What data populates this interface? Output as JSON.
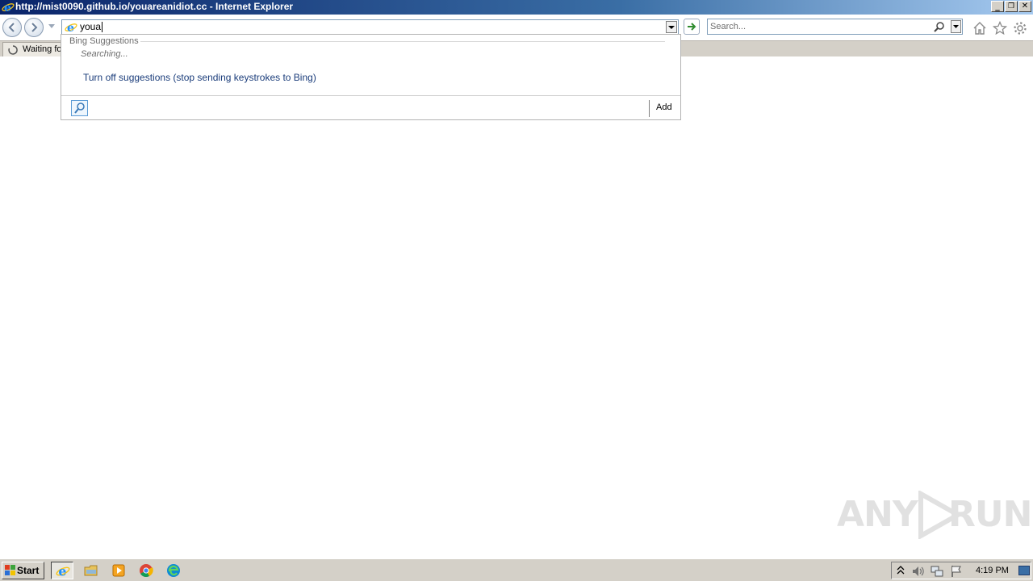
{
  "window": {
    "title": "http://mist0090.github.io/youareanidiot.cc - Internet Explorer",
    "controls": {
      "minimize": "_",
      "restore": "❐",
      "close": "✕"
    }
  },
  "navbar": {
    "address_value": "youa",
    "search_placeholder": "Search...",
    "icons": [
      "back-icon",
      "forward-icon",
      "ie-page-icon",
      "go-arrow-icon",
      "search-magnifier-icon",
      "home-icon",
      "favorites-star-icon",
      "tools-gear-icon"
    ]
  },
  "tab": {
    "label": "Waiting for"
  },
  "suggestions": {
    "header": "Bing Suggestions",
    "status": "Searching...",
    "turn_off": "Turn off suggestions (stop sending keystrokes to Bing)",
    "add_label": "Add"
  },
  "watermark": {
    "left": "ANY",
    "right": "RUN"
  },
  "taskbar": {
    "start_label": "Start",
    "clock": "4:19 PM",
    "apps": [
      "internet-explorer",
      "file-explorer",
      "media-player",
      "chrome",
      "edge"
    ]
  },
  "colors": {
    "titlebar_start": "#0a246a",
    "titlebar_end": "#a6caf0",
    "chrome_gray": "#d4d0c8",
    "link_blue": "#1a3c7a",
    "go_green": "#2e8b2e"
  }
}
